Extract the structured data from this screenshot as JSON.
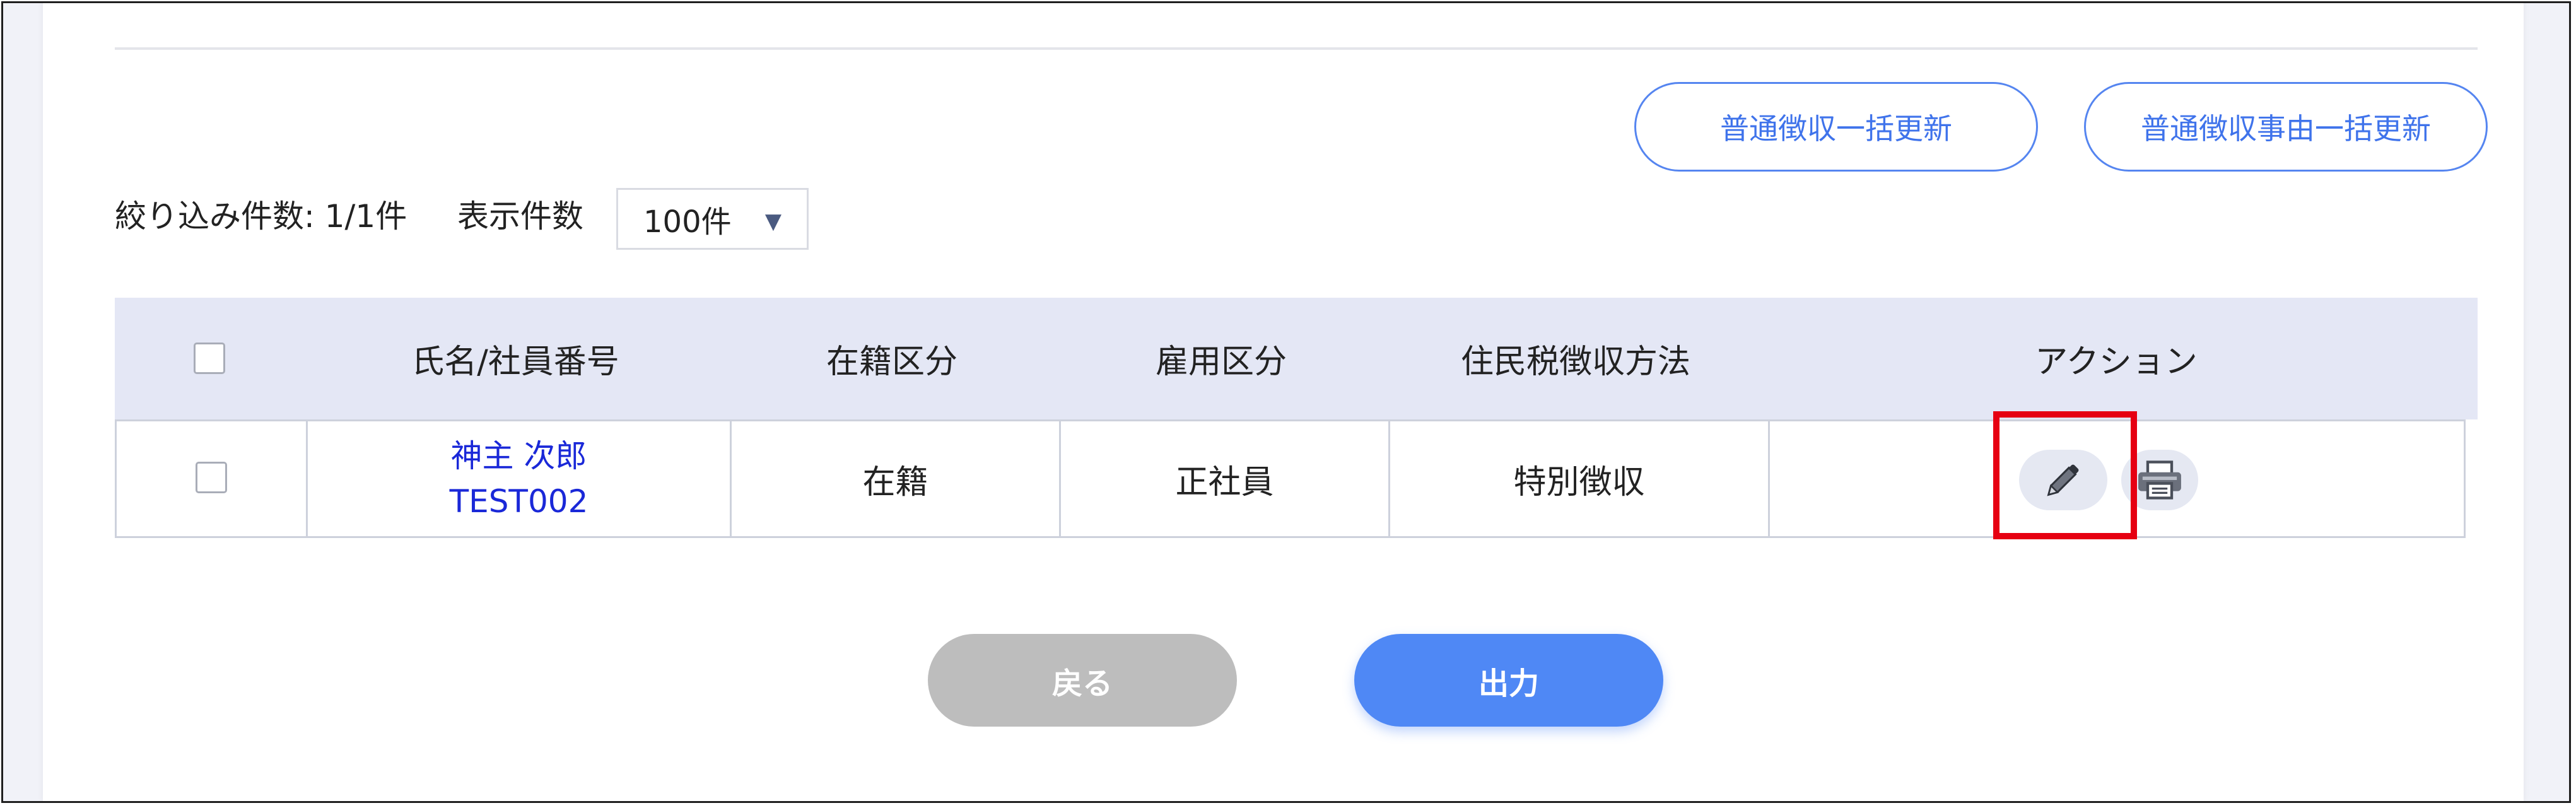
{
  "actions": {
    "bulk_update_label": "普通徴収一括更新",
    "bulk_reason_update_label": "普通徴収事由一括更新"
  },
  "filter": {
    "count_label": "絞り込み件数: 1/1件",
    "display_count_label": "表示件数",
    "display_count_value": "100件",
    "dropdown_arrow": "▼"
  },
  "table": {
    "headers": {
      "name": "氏名/社員番号",
      "enrollment": "在籍区分",
      "employment": "雇用区分",
      "tax_method": "住民税徴収方法",
      "action": "アクション"
    },
    "rows": [
      {
        "name": "神主 次郎",
        "employee_id": "TEST002",
        "enrollment": "在籍",
        "employment": "正社員",
        "tax_method": "特別徴収"
      }
    ]
  },
  "footer": {
    "back_label": "戻る",
    "output_label": "出力"
  },
  "icons": {
    "edit": "pencil-icon",
    "print": "printer-icon"
  },
  "colors": {
    "accent": "#4f88f5",
    "link": "#1a28d8",
    "highlight": "#e60012",
    "header_bg": "#e4e7f5",
    "back_button": "#bdbdbd"
  }
}
